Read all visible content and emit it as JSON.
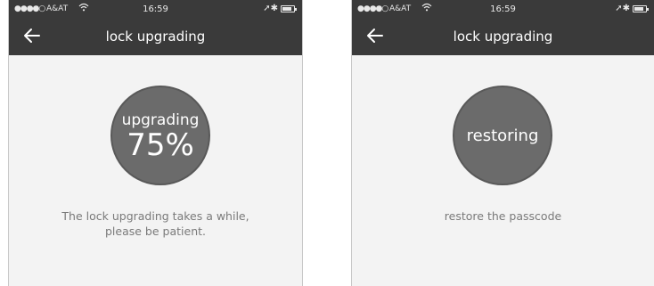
{
  "screens": [
    {
      "status": {
        "signal": "●●●●○",
        "carrier": "A&AT",
        "time": "16:59",
        "right": "➚✱"
      },
      "nav": {
        "title": "lock upgrading",
        "back_icon": "arrow-left-icon"
      },
      "progress": {
        "label": "upgrading",
        "percent": "75%"
      },
      "message_line1": "The lock upgrading takes a while,",
      "message_line2": "please be patient."
    },
    {
      "status": {
        "signal": "●●●●○",
        "carrier": "A&AT",
        "time": "16:59",
        "right": "➚✱"
      },
      "nav": {
        "title": "lock upgrading",
        "back_icon": "arrow-left-icon"
      },
      "progress": {
        "label": "restoring"
      },
      "message_line1": "restore the passcode"
    }
  ],
  "colors": {
    "bar": "#3a3a3a",
    "circle": "#6b6b6b",
    "background": "#f3f3f3",
    "message_text": "#7a7a7a"
  }
}
